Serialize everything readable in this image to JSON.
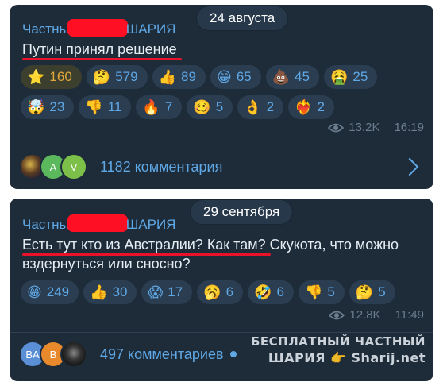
{
  "post1": {
    "date": "24 августа",
    "channel_left": "Частны",
    "channel_right": "ШАРИЯ",
    "text": "Путин принял решение",
    "reactions": [
      {
        "emoji": "⭐",
        "count": "160",
        "style": "gold",
        "icon": "star-icon"
      },
      {
        "emoji": "🤔",
        "count": "579",
        "icon": "thinking-face-icon"
      },
      {
        "emoji": "👍",
        "count": "89",
        "icon": "thumbs-up-icon"
      },
      {
        "emoji": "😁",
        "count": "65",
        "icon": "grinning-face-icon"
      },
      {
        "emoji": "💩",
        "count": "45",
        "icon": "poop-icon"
      },
      {
        "emoji": "🤮",
        "count": "25",
        "icon": "vomiting-face-icon"
      },
      {
        "emoji": "🤯",
        "count": "23",
        "icon": "exploding-head-icon"
      },
      {
        "emoji": "👎",
        "count": "11",
        "icon": "thumbs-down-icon"
      },
      {
        "emoji": "🔥",
        "count": "7",
        "icon": "fire-icon"
      },
      {
        "emoji": "🥴",
        "count": "5",
        "icon": "woozy-face-icon"
      },
      {
        "emoji": "👌",
        "count": "2",
        "icon": "ok-hand-icon"
      },
      {
        "emoji": "❤️‍🔥",
        "count": "2",
        "icon": "heart-on-fire-icon"
      }
    ],
    "views": "13.2K",
    "time": "16:19",
    "avatars": [
      "",
      "A",
      "V"
    ],
    "comments": "1182 комментария"
  },
  "post2": {
    "date": "29 сентября",
    "channel_left": "Частны",
    "channel_right": "ШАРИЯ",
    "text_underlined": "Есть тут кто из Австралии? Как там?",
    "text_rest": " Скукота, что можно вздернуться или сносно?",
    "reactions": [
      {
        "emoji": "😁",
        "count": "249",
        "icon": "grinning-face-icon"
      },
      {
        "emoji": "👍",
        "count": "30",
        "icon": "thumbs-up-icon"
      },
      {
        "emoji": "😱",
        "count": "17",
        "icon": "screaming-face-icon"
      },
      {
        "emoji": "🥱",
        "count": "6",
        "icon": "yawning-face-icon"
      },
      {
        "emoji": "🤣",
        "count": "6",
        "icon": "rolling-laughing-icon"
      },
      {
        "emoji": "👎",
        "count": "5",
        "icon": "thumbs-down-icon"
      },
      {
        "emoji": "🤔",
        "count": "5",
        "icon": "thinking-face-icon"
      }
    ],
    "views": "12.8K",
    "time": "11:49",
    "avatars": [
      "BA",
      "B",
      ""
    ],
    "comments": "497 комментариев"
  },
  "watermark": {
    "line1": "БЕСПЛАТНЫЙ  ЧАСТНЫЙ",
    "line2": "ШАРИЯ 👉 Sharij.net"
  },
  "colors": {
    "card_bg": "#1e2c3a",
    "accent": "#5fa8e6",
    "redaction": "#ff0f24",
    "underline": "#e8132a"
  }
}
